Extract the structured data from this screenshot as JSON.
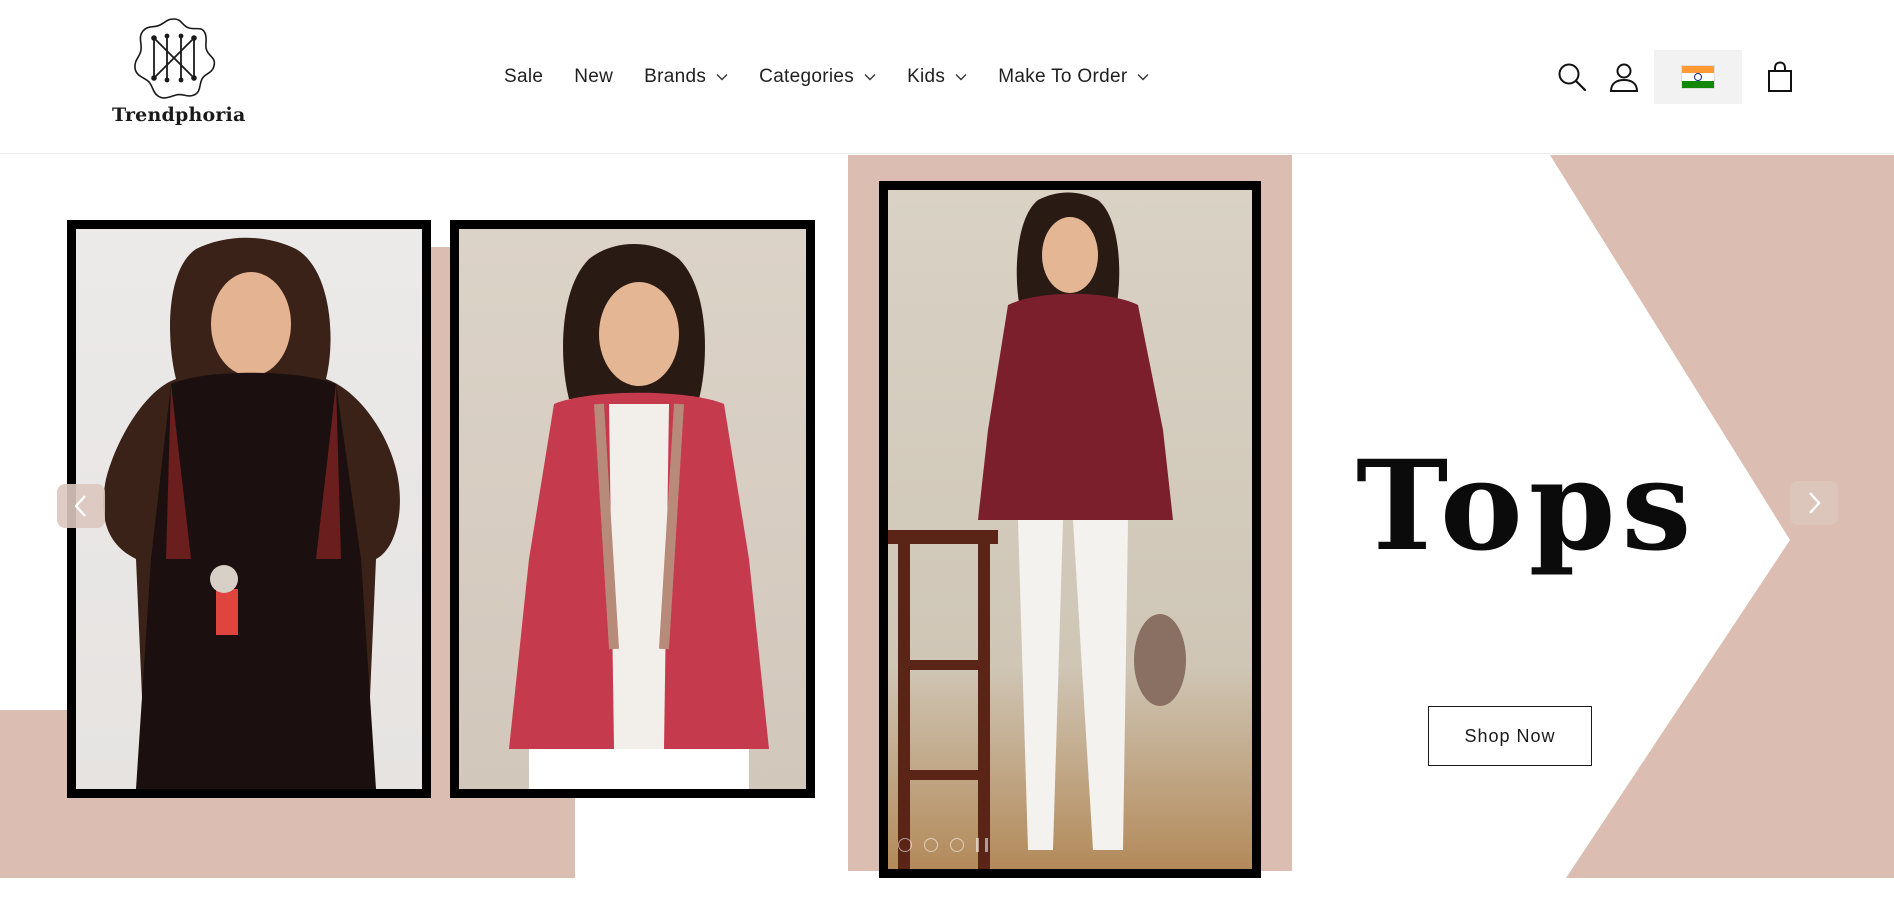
{
  "header": {
    "logo_text": "Trendphoria",
    "nav": [
      {
        "label": "Sale",
        "has_dropdown": false
      },
      {
        "label": "New",
        "has_dropdown": false
      },
      {
        "label": "Brands",
        "has_dropdown": true
      },
      {
        "label": "Categories",
        "has_dropdown": true
      },
      {
        "label": "Kids",
        "has_dropdown": true
      },
      {
        "label": "Make To Order",
        "has_dropdown": true
      }
    ],
    "icons": [
      "search-icon",
      "account-icon",
      "india-flag-icon",
      "cart-icon"
    ]
  },
  "banner": {
    "headline": "Tops",
    "cta_label": "Shop Now",
    "slides_count": 3,
    "accent_color": "#dbbdb1",
    "prev_icon": "chevron-left-icon",
    "next_icon": "chevron-right-icon"
  }
}
